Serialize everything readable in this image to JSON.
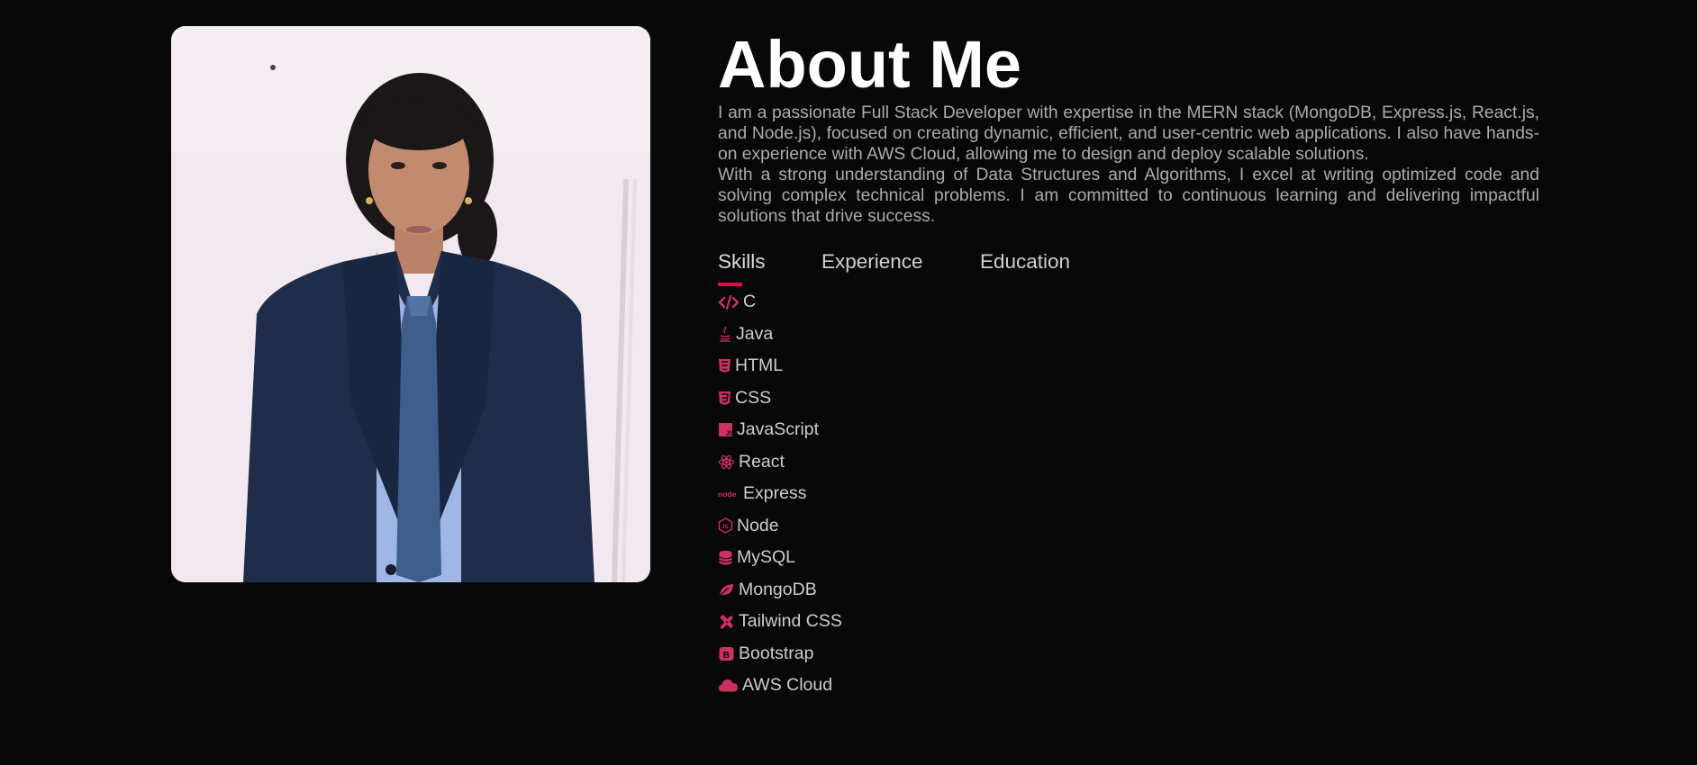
{
  "about": {
    "title": "About Me",
    "paragraph_1": "I am a passionate Full Stack Developer with expertise in the MERN stack (MongoDB, Express.js, React.js, and Node.js), focused on creating dynamic, efficient, and user-centric web applications. I also have hands-on experience with AWS Cloud, allowing me to design and deploy scalable solutions.",
    "paragraph_2": "With a strong understanding of Data Structures and Algorithms, I excel at writing optimized code and solving complex technical problems. I am committed to continuous learning and delivering impactful solutions that drive success."
  },
  "tabs": [
    {
      "label": "Skills",
      "active": true
    },
    {
      "label": "Experience",
      "active": false
    },
    {
      "label": "Education",
      "active": false
    }
  ],
  "skills": [
    {
      "label": "C",
      "icon": "code-icon"
    },
    {
      "label": "Java",
      "icon": "java-icon"
    },
    {
      "label": "HTML",
      "icon": "html5-icon"
    },
    {
      "label": "CSS",
      "icon": "css3-icon"
    },
    {
      "label": "JavaScript",
      "icon": "javascript-icon"
    },
    {
      "label": "React",
      "icon": "react-icon"
    },
    {
      "label": "Express",
      "icon": "node-logo-icon"
    },
    {
      "label": "Node",
      "icon": "nodejs-hexagon-icon"
    },
    {
      "label": "MySQL",
      "icon": "database-icon"
    },
    {
      "label": "MongoDB",
      "icon": "leaf-icon"
    },
    {
      "label": "Tailwind CSS",
      "icon": "tools-icon"
    },
    {
      "label": "Bootstrap",
      "icon": "bootstrap-icon"
    },
    {
      "label": "AWS Cloud",
      "icon": "cloud-icon"
    }
  ],
  "colors": {
    "background": "#080808",
    "accent": "#ff004f",
    "icon": "#c9315f",
    "text_muted": "#ababab",
    "heading": "#ffffff"
  }
}
